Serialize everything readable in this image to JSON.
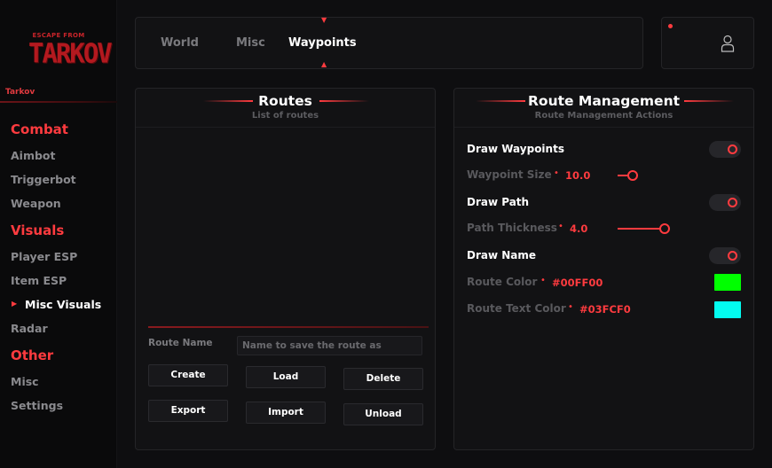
{
  "app": {
    "logo_line1": "ESCAPE FROM",
    "logo_line2": "TARKOV",
    "name": "Tarkov"
  },
  "sidebar": {
    "categories": [
      {
        "label": "Combat",
        "items": [
          "Aimbot",
          "Triggerbot",
          "Weapon"
        ]
      },
      {
        "label": "Visuals",
        "items": [
          "Player ESP",
          "Item ESP",
          "Misc Visuals",
          "Radar"
        ]
      },
      {
        "label": "Other",
        "items": [
          "Misc",
          "Settings"
        ]
      }
    ],
    "active_item": "Misc Visuals"
  },
  "tabs": {
    "items": [
      "World",
      "Misc",
      "Waypoints"
    ],
    "active": "Waypoints"
  },
  "user": {
    "icon": "user-icon",
    "status": "online-dot"
  },
  "routes": {
    "title": "Routes",
    "subtitle": "List of routes",
    "route_name_label": "Route Name",
    "route_name_placeholder": "Name to save the route as",
    "route_name_value": "",
    "buttons": {
      "create": "Create",
      "load": "Load",
      "delete": "Delete",
      "export": "Export",
      "import": "Import",
      "unload": "Unload"
    }
  },
  "management": {
    "title": "Route Management",
    "subtitle": "Route Management Actions",
    "draw_waypoints": {
      "label": "Draw Waypoints",
      "enabled": true
    },
    "waypoint_size": {
      "label": "Waypoint Size",
      "value": "10.0",
      "fraction": 0.11
    },
    "draw_path": {
      "label": "Draw Path",
      "enabled": true
    },
    "path_thickness": {
      "label": "Path Thickness",
      "value": "4.0",
      "fraction": 0.39
    },
    "draw_name": {
      "label": "Draw Name",
      "enabled": true
    },
    "route_color": {
      "label": "Route Color",
      "value": "#00FF00"
    },
    "route_text_color": {
      "label": "Route Text Color",
      "value": "#03FCF0"
    }
  },
  "colors": {
    "accent": "#ff3b3f",
    "background": "#0e0e10",
    "panel": "#121214"
  }
}
